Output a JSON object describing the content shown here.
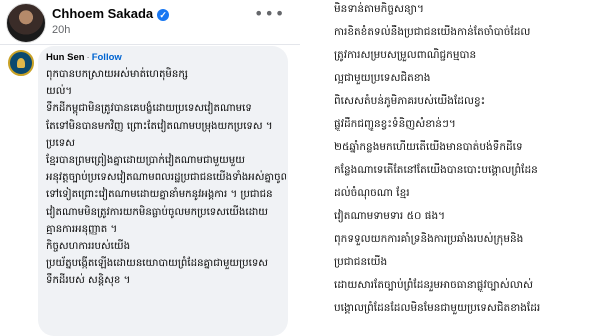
{
  "post": {
    "author": "Chhoem Sakada",
    "verified_icon": "✓",
    "time": "20h",
    "more_icon": "•••"
  },
  "comment": {
    "author": "Hun Sen",
    "separator": "·",
    "follow_label": "Follow",
    "lines": [
      "ពុកបានបកស្រាយអស់មាត់ហេតុមិនក្ស",
      "យល់។",
      "ទឹកដីកម្ពុជាមិនត្រូវបានគេបង្ខំដោយប្រទេសវៀតណាមទេ",
      "តែទៅមិនបានមកវិញ ព្រោះតែវៀតណាមបម្រុងយកប្រទេស ។",
      "ប្រទេស",
      "ខ្មែរបានព្រមព្រៀងគ្នាដោយប្រាក់វៀតណាមជាមួយមួយ",
      "អនុវត្តច្បាប់ប្រទេសវៀតណាមពលរដ្ឋប្រជាជនយើងទាំងអស់គ្នាចូល",
      "ទៅទៀតព្រោះវៀតណាមដោយគ្នានាំមកនូវអង្គការ ។ ប្រជាជន",
      "វៀតណាមមិនត្រូវការយកមិនធ្លាប់ចូលមកប្រទេសយើងដោយ",
      "គ្មានការអនុញ្ញាត ។",
      "កិច្ចសហការរបស់យើង",
      "ប្រយ័ត្នបង្កើតឡើងដោយនយោបាយព្រំដែនគ្នាជាមួយប្រទេស",
      "ទឹកដីរបស់ សន្តិសុខ ។"
    ]
  },
  "right_text": [
    "មិនទាន់តាមកិច្ចសន្យា។",
    "ការខិតខំតទល់នឹងប្រជាជនយើងកាន់តែចាំបាច់ដែល",
    "ត្រូវការសម្របសម្រួលពាណិជ្ជកម្មបាន",
    "ល្អជាមួយប្រទេសជិតខាង",
    "ពិសេសតំបន់ភូមិភាគរបស់យើងដែលខ្វះ",
    "ផ្លូវដឹកជញ្ជូនខ្វះទំនិញសំខាន់ៗ។",
    "២៥ឆ្នាំកន្លងមកហើយតើយើងមានបាត់បង់ទឹកដីទេ",
    "កន្លែងណាទេតើតែនៅតែយើងបានបោះបង្គោលព្រំដែន",
    "ដល់ចំណុចណា ខ្មែរ",
    "វៀតណាមទាមទារ ៥០ ផង។",
    "ពុកទទួលយកការគាំទ្រនិងការប្រឆាំងរបស់ក្រុមនិង",
    "ប្រជាជនយើង",
    "ដោយសារតែច្បាប់ព្រំដែនរួមអាចធានាផ្លូវច្បាស់លាស់",
    "បង្គោលព្រំដែនដែលមិនមែនជាមួយប្រទេសជិតខាងដែរ"
  ]
}
